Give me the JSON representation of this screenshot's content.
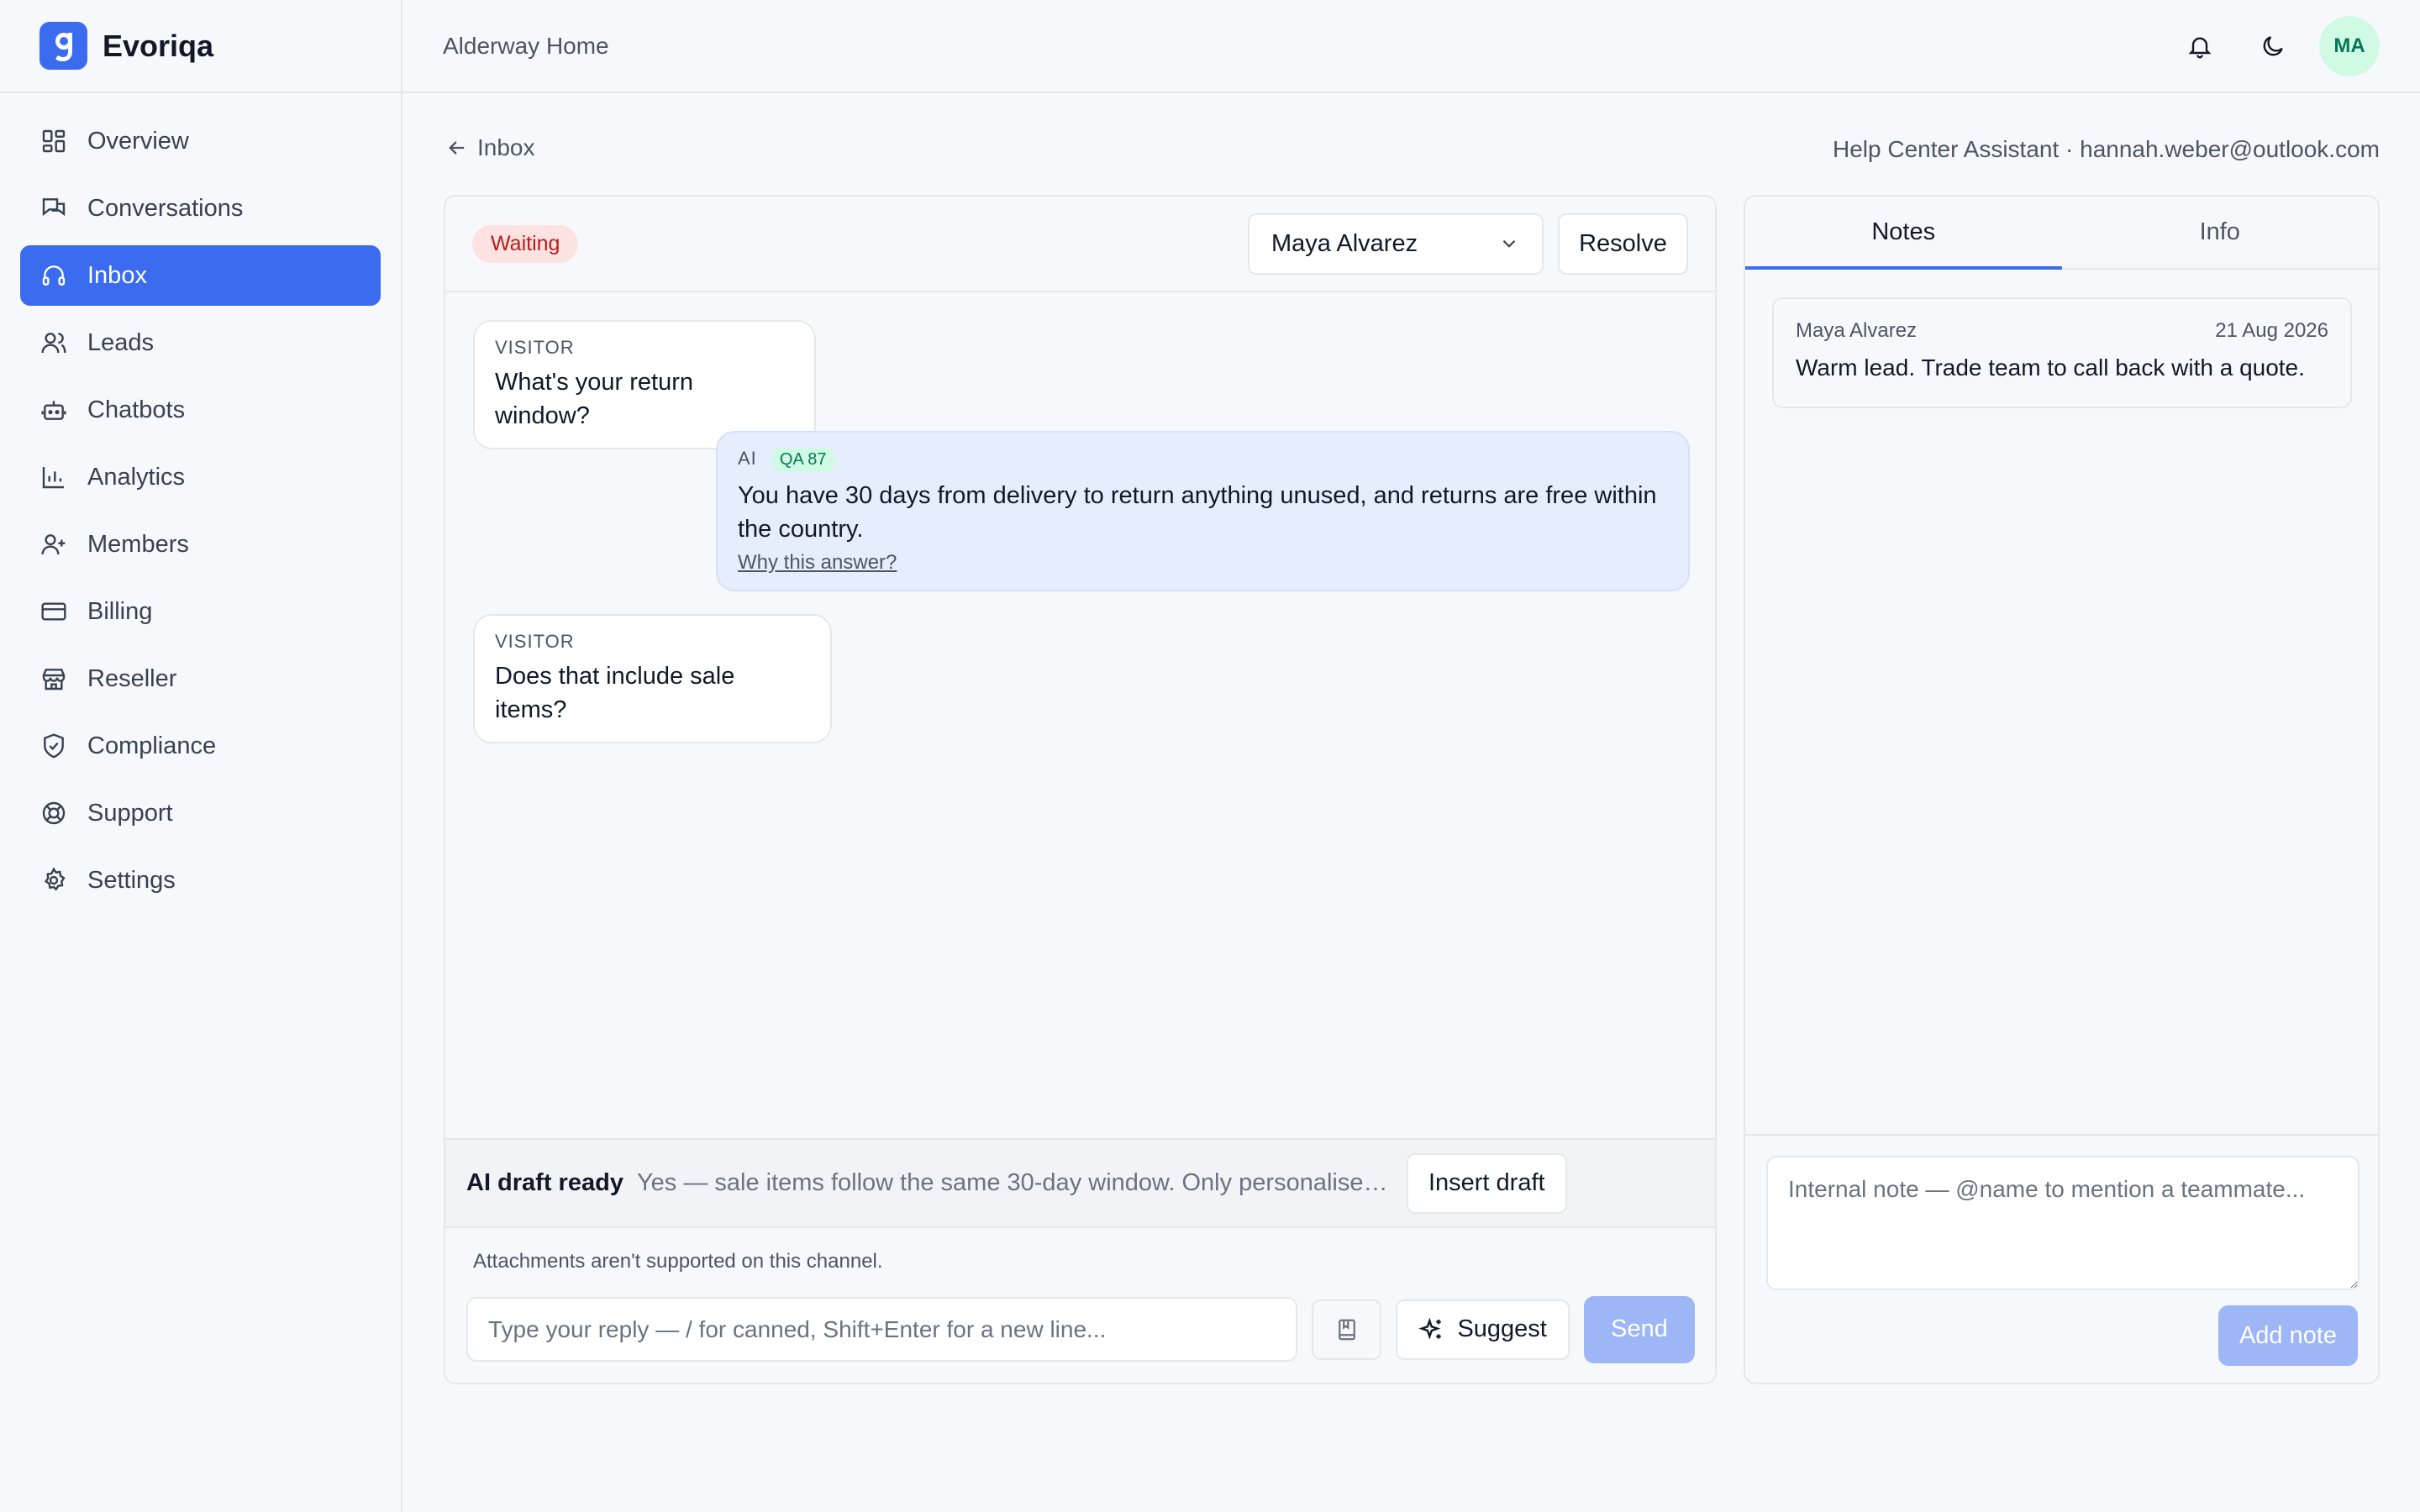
{
  "app": {
    "name": "Evoriqa",
    "brand_color": "#3b6cf0"
  },
  "sidebar": {
    "items": [
      {
        "label": "Overview",
        "icon": "grid-icon"
      },
      {
        "label": "Conversations",
        "icon": "chat-bubbles-icon"
      },
      {
        "label": "Inbox",
        "icon": "headset-icon",
        "active": true
      },
      {
        "label": "Leads",
        "icon": "users-icon"
      },
      {
        "label": "Chatbots",
        "icon": "bot-icon"
      },
      {
        "label": "Analytics",
        "icon": "bar-chart-icon"
      },
      {
        "label": "Members",
        "icon": "user-plus-icon"
      },
      {
        "label": "Billing",
        "icon": "credit-card-icon"
      },
      {
        "label": "Reseller",
        "icon": "store-icon"
      },
      {
        "label": "Compliance",
        "icon": "shield-check-icon"
      },
      {
        "label": "Support",
        "icon": "life-buoy-icon"
      },
      {
        "label": "Settings",
        "icon": "gear-icon"
      }
    ]
  },
  "topbar": {
    "workspace": "Alderway Home",
    "avatar_initials": "MA"
  },
  "breadcrumb": {
    "back_label": "Inbox",
    "assistant_meta": "Help Center Assistant · hannah.weber@outlook.com"
  },
  "conversation": {
    "status": "Waiting",
    "assignee": "Maya Alvarez",
    "resolve_label": "Resolve",
    "messages": [
      {
        "role": "VISITOR",
        "text": "What's your return window?"
      },
      {
        "role": "AI",
        "badge": "QA 87",
        "text": "You have 30 days from delivery to return anything unused, and returns are free within the country.",
        "link": "Why this answer?"
      },
      {
        "role": "VISITOR",
        "text": "Does that include sale items?"
      }
    ],
    "draft": {
      "title": "AI draft ready",
      "text": "Yes — sale items follow the same 30-day window. Only personalised ...",
      "insert_label": "Insert draft"
    },
    "attachments_note": "Attachments aren't supported on this channel.",
    "reply_placeholder": "Type your reply — / for canned, Shift+Enter for a new line...",
    "suggest_label": "Suggest",
    "send_label": "Send"
  },
  "side_panel": {
    "tabs": [
      {
        "label": "Notes",
        "active": true
      },
      {
        "label": "Info"
      }
    ],
    "notes": [
      {
        "author": "Maya Alvarez",
        "date": "21 Aug 2026",
        "text": "Warm lead. Trade team to call back with a quote."
      }
    ],
    "note_placeholder": "Internal note — @name to mention a teammate...",
    "add_note_label": "Add note"
  }
}
